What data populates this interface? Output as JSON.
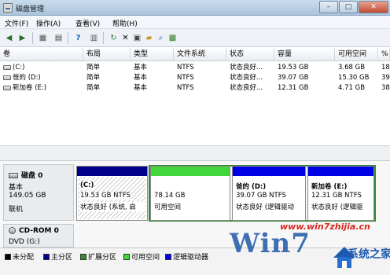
{
  "window": {
    "title": "磁盘管理"
  },
  "menu": [
    "文件(F)",
    "操作(A)",
    "查看(V)",
    "帮助(H)"
  ],
  "toolbar": {
    "icons": [
      "back-icon",
      "forward-icon",
      "console-tree-icon",
      "properties-icon",
      "help-icon",
      "rescan-icon",
      "delete-icon",
      "properties2-icon",
      "open-folder-icon",
      "search-icon",
      "disk-icon"
    ]
  },
  "volumes_table": {
    "headers": [
      "卷",
      "布局",
      "类型",
      "文件系统",
      "状态",
      "容量",
      "可用空间",
      "%"
    ],
    "rows": [
      {
        "volume": "(C:)",
        "layout": "简单",
        "type": "基本",
        "fs": "NTFS",
        "status": "状态良好...",
        "capacity": "19.53 GB",
        "free": "3.68 GB",
        "pct": "18"
      },
      {
        "volume": "爸的 (D:)",
        "layout": "简单",
        "type": "基本",
        "fs": "NTFS",
        "status": "状态良好...",
        "capacity": "39.07 GB",
        "free": "15.30 GB",
        "pct": "39"
      },
      {
        "volume": "新加卷 (E:)",
        "layout": "简单",
        "type": "基本",
        "fs": "NTFS",
        "status": "状态良好...",
        "capacity": "12.31 GB",
        "free": "4.71 GB",
        "pct": "38"
      }
    ]
  },
  "disk0": {
    "name": "磁盘 0",
    "type": "基本",
    "size": "149.05 GB",
    "state": "联机",
    "partitions": [
      {
        "title": "(C:)",
        "size": "19.53 GB NTFS",
        "status": "状态良好 (系统, 启",
        "bar_color": "#00008b"
      },
      {
        "title": "",
        "size": "78.14 GB",
        "status": "可用空间",
        "bar_color": "#41d63a"
      },
      {
        "title": "爸的  (D:)",
        "size": "39.07 GB NTFS",
        "status": "状态良好 (逻辑驱动",
        "bar_color": "#0000e6"
      },
      {
        "title": "新加卷  (E:)",
        "size": "12.31 GB NTFS",
        "status": "状态良好 (逻辑驱",
        "bar_color": "#0000e6"
      }
    ]
  },
  "cdrom0": {
    "name": "CD-ROM 0",
    "drive": "DVD (G:)"
  },
  "legend": [
    {
      "label": "未分配",
      "color": "#000000"
    },
    {
      "label": "主分区",
      "color": "#00008b"
    },
    {
      "label": "扩展分区",
      "color": "#2e8b2e"
    },
    {
      "label": "可用空间",
      "color": "#41d63a"
    },
    {
      "label": "逻辑驱动器",
      "color": "#0000e6"
    }
  ],
  "watermark": {
    "url": "www.win7zhijia.cn",
    "big": "Win7",
    "logo": "系统之家"
  }
}
